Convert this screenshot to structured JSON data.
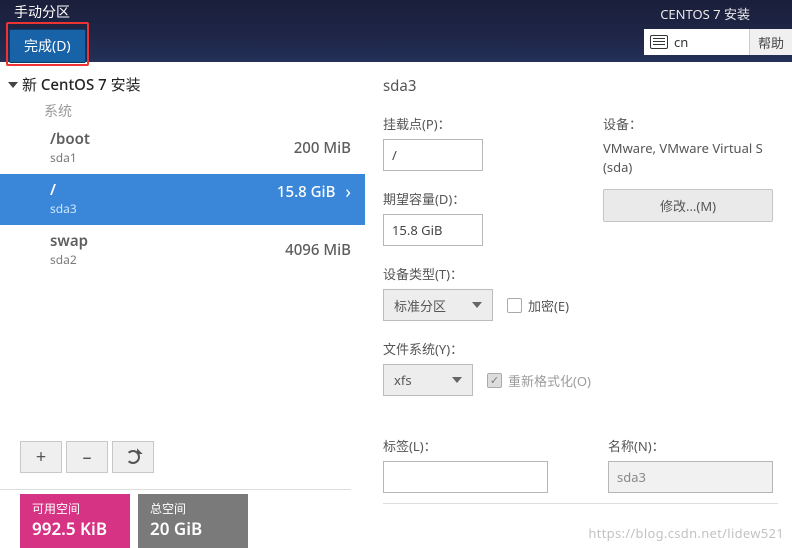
{
  "header": {
    "page_title": "手动分区",
    "done_label": "完成(D)",
    "install_title": "CENTOS 7 安装",
    "lang": "cn",
    "help_label": "帮助"
  },
  "tree": {
    "root_label": "新 CentOS 7 安装",
    "system_label": "系统",
    "partitions": [
      {
        "mount": "/boot",
        "device": "sda1",
        "size": "200 MiB",
        "selected": false
      },
      {
        "mount": "/",
        "device": "sda3",
        "size": "15.8 GiB",
        "selected": true
      },
      {
        "mount": "swap",
        "device": "sda2",
        "size": "4096 MiB",
        "selected": false
      }
    ]
  },
  "details": {
    "title": "sda3",
    "mount_label": "挂载点(P)：",
    "mount_value": "/",
    "cap_label": "期望容量(D)：",
    "cap_value": "15.8 GiB",
    "device_label": "设备：",
    "device_name": "VMware, VMware Virtual S (sda)",
    "modify_label": "修改...(M)",
    "type_label": "设备类型(T)：",
    "type_value": "标准分区",
    "encrypt_label": "加密(E)",
    "fs_label": "文件系统(Y)：",
    "fs_value": "xfs",
    "reformat_label": "重新格式化(O)",
    "tag_label": "标签(L)：",
    "tag_value": "",
    "name_label": "名称(N)：",
    "name_value": "sda3"
  },
  "footer": {
    "free_label": "可用空间",
    "free_value": "992.5 KiB",
    "total_label": "总空间",
    "total_value": "20 GiB"
  },
  "watermark": "https://blog.csdn.net/lidew521"
}
